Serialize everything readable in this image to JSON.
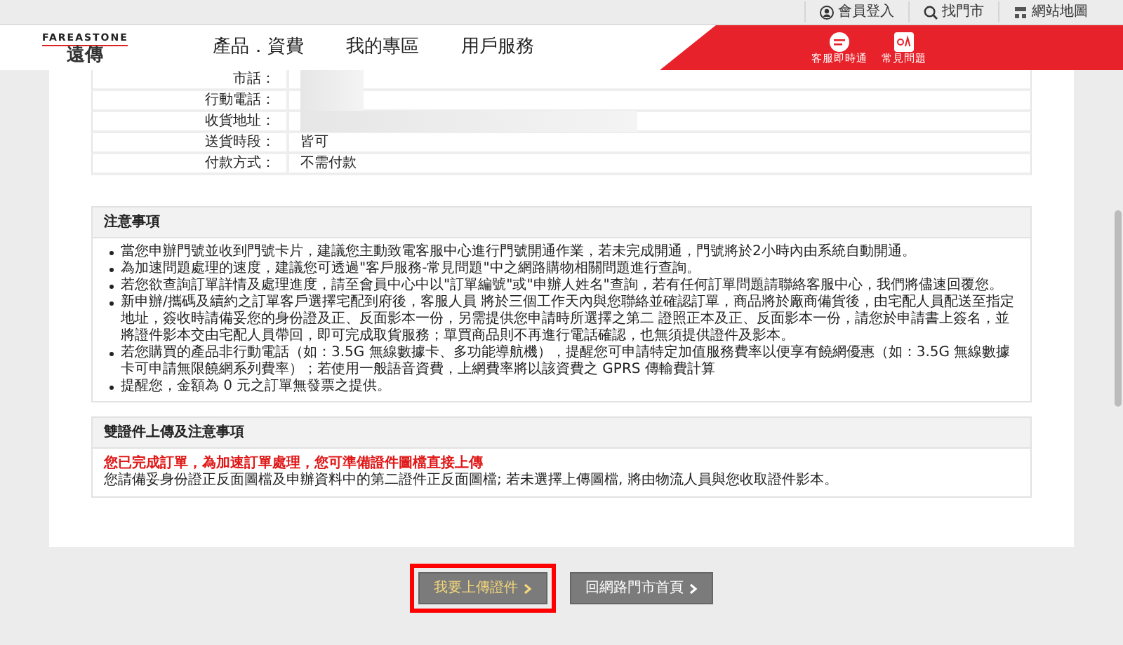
{
  "top_links": [
    {
      "label": "會員登入"
    },
    {
      "label": "找門市"
    },
    {
      "label": "網站地圖"
    }
  ],
  "logo": {
    "brand": "FAREASTONE",
    "name": "遠傳"
  },
  "nav": [
    "產品．資費",
    "我的專區",
    "用戶服務"
  ],
  "quick_links": [
    {
      "label": "客服即時通"
    },
    {
      "label": "常見問題"
    }
  ],
  "order_info": [
    {
      "label": "市話：",
      "redacted": true
    },
    {
      "label": "行動電話：",
      "redacted": true
    },
    {
      "label": "收貨地址：",
      "redacted": true
    },
    {
      "label": "送貨時段：",
      "value": "皆可",
      "redacted": false
    },
    {
      "label": "付款方式：",
      "value": "不需付款",
      "redacted": false
    }
  ],
  "notice": {
    "title": "注意事項",
    "items": [
      "當您申辦門號並收到門號卡片，建議您主動致電客服中心進行門號開通作業，若未完成開通，門號將於2小時內由系統自動開通。",
      "為加速問題處理的速度，建議您可透過\"客戶服務-常見問題\"中之網路購物相關問題進行查詢。",
      "若您欲查詢訂單詳情及處理進度，請至會員中心中以\"訂單編號\"或\"申辦人姓名\"查詢，若有任何訂單問題請聯絡客服中心，我們將儘速回覆您。",
      "新申辦/攜碼及續約之訂單客戶選擇宅配到府後，客服人員 將於三個工作天內與您聯絡並確認訂單，商品將於廠商備貨後，由宅配人員配送至指定地址，簽收時請備妥您的身份證及正、反面影本一份，另需提供您申請時所選擇之第二 證照正本及正、反面影本一份，請您於申請書上簽名，並將證件影本交由宅配人員帶回，即可完成取貨服務；單買商品則不再進行電話確認，也無須提供證件及影本。",
      "若您購買的產品非行動電話（如：3.5G 無線數據卡、多功能導航機），提醒您可申請特定加值服務費率以便享有饒網優惠（如：3.5G 無線數據卡可申請無限饒網系列費率）；若使用一般語音資費，上網費率將以該資費之 GPRS 傳輸費計算",
      "提醒您，金額為 0 元之訂單無發票之提供。"
    ]
  },
  "upload": {
    "title": "雙證件上傳及注意事項",
    "lines": [
      {
        "text": "您已完成訂單，為加速訂單處理，您可準備證件圖檔直接上傳",
        "kind": "alert"
      },
      {
        "text": "您請備妥身份證正反面圖檔及申辦資料中的第二證件正反面圖檔; 若未選擇上傳圖檔, 將由物流人員與您收取證件影本。",
        "kind": "plain"
      }
    ]
  },
  "buttons": [
    {
      "label": "我要上傳證件",
      "highlighted": true
    },
    {
      "label": "回網路門市首頁",
      "highlighted": false
    }
  ]
}
